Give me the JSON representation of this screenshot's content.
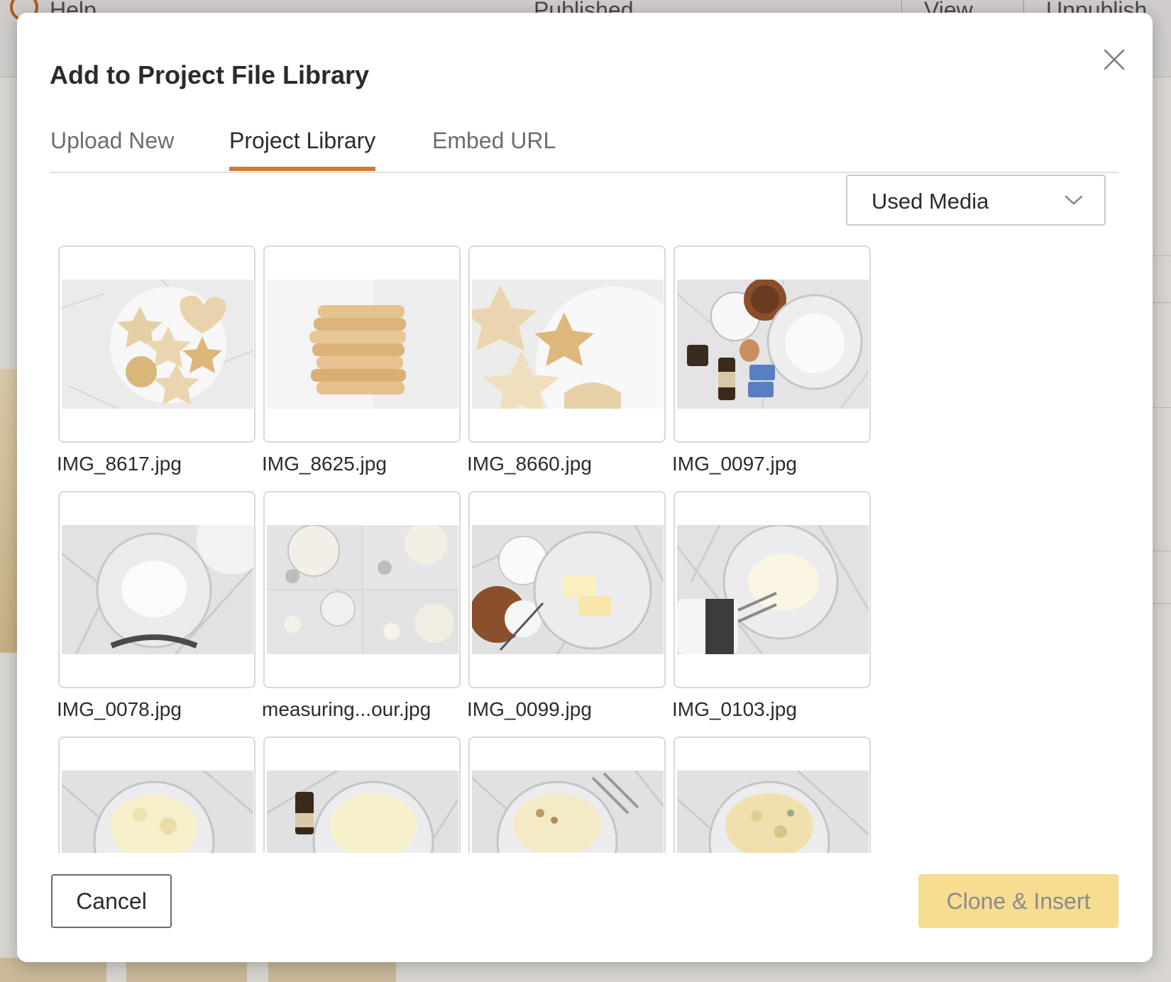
{
  "background": {
    "help_label": "Help",
    "published_label": "Published",
    "view_label": "View",
    "unpublish_label": "Unpublish"
  },
  "modal": {
    "title": "Add to Project File Library",
    "close_icon": "close-icon",
    "tabs": [
      {
        "label": "Upload New",
        "active": false
      },
      {
        "label": "Project Library",
        "active": true
      },
      {
        "label": "Embed URL",
        "active": false
      }
    ],
    "filter": {
      "selected": "Used Media",
      "icon": "chevron-down-icon"
    },
    "files": [
      {
        "name": "IMG_8617.jpg"
      },
      {
        "name": "IMG_8625.jpg"
      },
      {
        "name": "IMG_8660.jpg"
      },
      {
        "name": "IMG_0097.jpg"
      },
      {
        "name": "IMG_0078.jpg"
      },
      {
        "name": "measuring...our.jpg"
      },
      {
        "name": "IMG_0099.jpg"
      },
      {
        "name": "IMG_0103.jpg"
      },
      {
        "name": ""
      },
      {
        "name": ""
      },
      {
        "name": ""
      },
      {
        "name": ""
      }
    ],
    "buttons": {
      "cancel_label": "Cancel",
      "clone_insert_label": "Clone & Insert"
    }
  },
  "colors": {
    "accent": "#d07a35",
    "primary_disabled": "#f7dd92",
    "text_dark": "#2b2b2b",
    "text_muted": "#6d6d6d"
  }
}
